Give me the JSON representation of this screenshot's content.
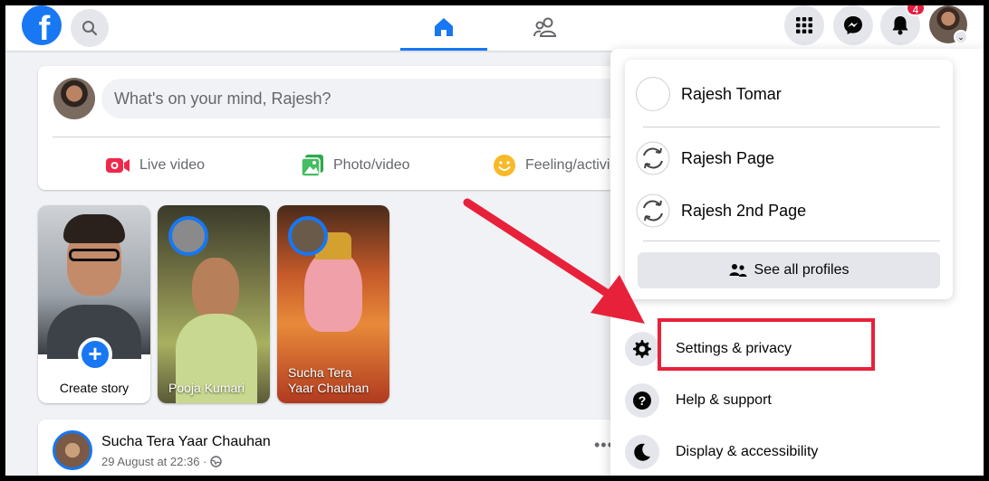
{
  "nav": {
    "logo": "f",
    "notification_count": "4"
  },
  "composer": {
    "placeholder": "What's on your mind, Rajesh?",
    "actions": [
      {
        "label": "Live video"
      },
      {
        "label": "Photo/video"
      },
      {
        "label": "Feeling/activi"
      }
    ]
  },
  "stories": {
    "create_label": "Create story",
    "items": [
      {
        "name": "Pooja Kumari"
      },
      {
        "name": "Sucha Tera Yaar Chauhan"
      }
    ]
  },
  "post": {
    "author": "Sucha Tera Yaar Chauhan",
    "timestamp": "29 August at 22:36 ·",
    "more": "•••"
  },
  "menu": {
    "profiles": [
      {
        "name": "Rajesh Tomar"
      },
      {
        "name": "Rajesh Page"
      },
      {
        "name": "Rajesh 2nd Page"
      }
    ],
    "see_all": "See all profiles",
    "items": [
      {
        "label": "Settings & privacy",
        "icon": "gear-icon"
      },
      {
        "label": "Help & support",
        "icon": "question-icon"
      },
      {
        "label": "Display & accessibility",
        "icon": "moon-icon"
      }
    ]
  },
  "colors": {
    "brand": "#1877f2",
    "annotation": "#e8213a",
    "badge": "#e41e3f",
    "background": "#f0f2f5"
  }
}
